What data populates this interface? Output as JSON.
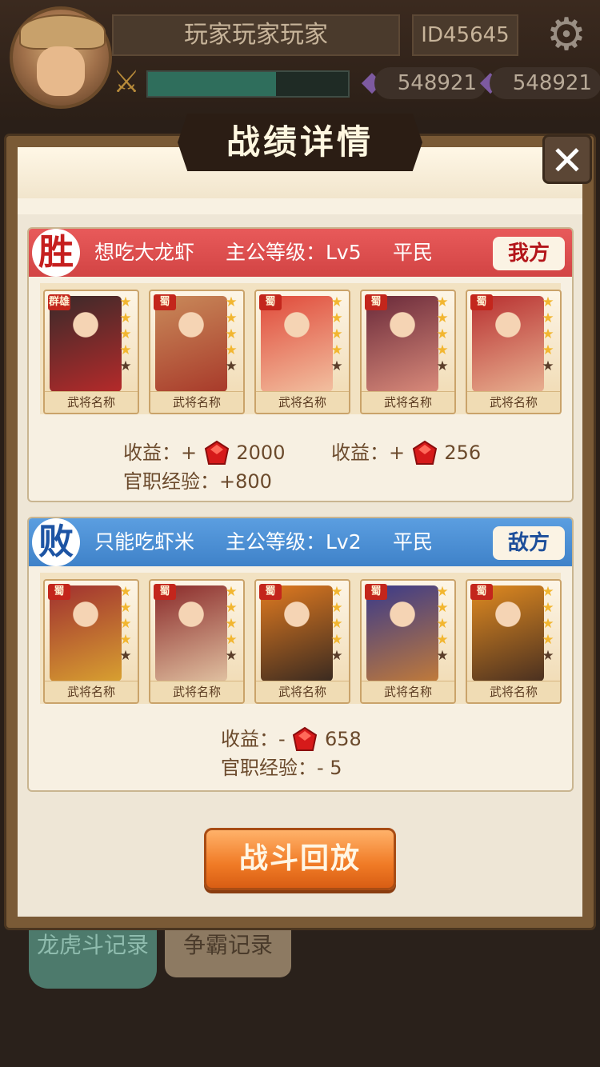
{
  "header": {
    "player_name": "玩家玩家玩家",
    "player_id": "ID45645",
    "exp_progress": 0.64,
    "currency_1": "548921",
    "currency_2": "548921"
  },
  "popup": {
    "title": "战绩详情",
    "close_label": "✕"
  },
  "win_panel": {
    "result": "胜",
    "player": "想吃大龙虾",
    "level_label": "主公等级：Lv5",
    "rank": "平民",
    "side": "我方",
    "cards": [
      {
        "faction": "群雄",
        "name": "武将名称",
        "stars": 4
      },
      {
        "faction": "蜀",
        "name": "武将名称",
        "stars": 4
      },
      {
        "faction": "蜀",
        "name": "武将名称",
        "stars": 4
      },
      {
        "faction": "蜀",
        "name": "武将名称",
        "stars": 4
      },
      {
        "faction": "蜀",
        "name": "武将名称",
        "stars": 4
      }
    ],
    "income_label_1": "收益：+",
    "income_value_1": "2000",
    "income_label_2": "收益：+",
    "income_value_2": "256",
    "exp_label": "官职经验：+800"
  },
  "lose_panel": {
    "result": "败",
    "player": "只能吃虾米",
    "level_label": "主公等级：Lv2",
    "rank": "平民",
    "side": "敌方",
    "cards": [
      {
        "faction": "蜀",
        "name": "武将名称",
        "stars": 4
      },
      {
        "faction": "蜀",
        "name": "武将名称",
        "stars": 4
      },
      {
        "faction": "蜀",
        "name": "武将名称",
        "stars": 4
      },
      {
        "faction": "蜀",
        "name": "武将名称",
        "stars": 4
      },
      {
        "faction": "蜀",
        "name": "武将名称",
        "stars": 4
      }
    ],
    "income_label": "收益：-",
    "income_value": "658",
    "exp_label": "官职经验：- 5"
  },
  "replay_button": "战斗回放",
  "tabs": {
    "tab_1": "龙虎斗记录",
    "tab_2": "争霸记录"
  },
  "icons": {
    "settings": "gear-icon",
    "gem": "purple-gem-icon",
    "ruby": "ruby-icon",
    "star": "star-icon"
  },
  "colors": {
    "win_header": "#d24444",
    "lose_header": "#3f82c9",
    "replay_button": "#f07a25",
    "star": "#f2b630"
  }
}
